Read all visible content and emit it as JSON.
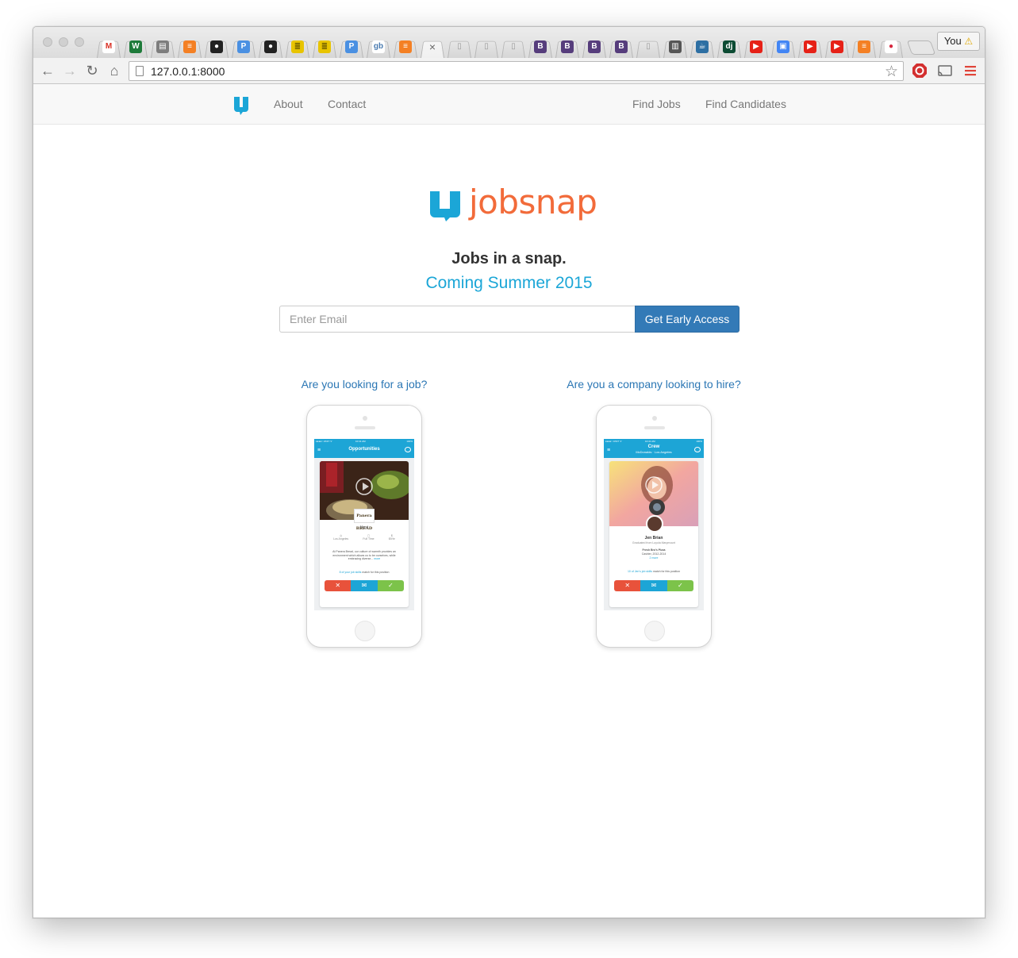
{
  "browser": {
    "profile_label": "You",
    "profile_warning": "⚠",
    "url": "127.0.0.1:8000",
    "tabs": [
      {
        "icon": "gmail-icon",
        "glyph": "M",
        "color": "#ffffff",
        "fg": "#d93025"
      },
      {
        "icon": "workflowy-icon",
        "glyph": "W",
        "color": "#1e7b3a",
        "fg": "#ffffff"
      },
      {
        "icon": "folder-icon",
        "glyph": "▤",
        "color": "#7d7d7d",
        "fg": "#ffffff"
      },
      {
        "icon": "stackoverflow-icon",
        "glyph": "≡",
        "color": "#f48024",
        "fg": "#ffffff"
      },
      {
        "icon": "github-icon",
        "glyph": "●",
        "color": "#222222",
        "fg": "#ffffff"
      },
      {
        "icon": "p-icon",
        "glyph": "P",
        "color": "#4a90e2",
        "fg": "#ffffff"
      },
      {
        "icon": "github-icon",
        "glyph": "●",
        "color": "#222222",
        "fg": "#ffffff"
      },
      {
        "icon": "database-icon",
        "glyph": "≣",
        "color": "#e8c400",
        "fg": "#5a4b00"
      },
      {
        "icon": "database-icon",
        "glyph": "≣",
        "color": "#e8c400",
        "fg": "#5a4b00"
      },
      {
        "icon": "p-icon",
        "glyph": "P",
        "color": "#4a90e2",
        "fg": "#ffffff"
      },
      {
        "icon": "gb-icon",
        "glyph": "gb",
        "color": "#ffffff",
        "fg": "#4a7bb0"
      },
      {
        "icon": "stackoverflow-icon",
        "glyph": "≡",
        "color": "#f48024",
        "fg": "#ffffff"
      },
      {
        "icon": "close-icon",
        "glyph": "×",
        "color": "transparent",
        "fg": "#666666"
      },
      {
        "icon": "page-icon",
        "glyph": "▯",
        "color": "transparent",
        "fg": "#999999"
      },
      {
        "icon": "page-icon",
        "glyph": "▯",
        "color": "transparent",
        "fg": "#999999"
      },
      {
        "icon": "page-icon",
        "glyph": "▯",
        "color": "transparent",
        "fg": "#999999"
      },
      {
        "icon": "bootstrap-icon",
        "glyph": "B",
        "color": "#563d7c",
        "fg": "#ffffff"
      },
      {
        "icon": "bootstrap-icon",
        "glyph": "B",
        "color": "#563d7c",
        "fg": "#ffffff"
      },
      {
        "icon": "bootstrap-icon",
        "glyph": "B",
        "color": "#563d7c",
        "fg": "#ffffff"
      },
      {
        "icon": "bootstrap-icon",
        "glyph": "B",
        "color": "#563d7c",
        "fg": "#ffffff"
      },
      {
        "icon": "page-icon",
        "glyph": "▯",
        "color": "transparent",
        "fg": "#999999"
      },
      {
        "icon": "columns-icon",
        "glyph": "▥",
        "color": "#555555",
        "fg": "#ffffff"
      },
      {
        "icon": "cup-icon",
        "glyph": "☕",
        "color": "#2d6fa3",
        "fg": "#ffffff"
      },
      {
        "icon": "django-icon",
        "glyph": "dj",
        "color": "#0c4b33",
        "fg": "#ffffff"
      },
      {
        "icon": "youtube-icon",
        "glyph": "▶",
        "color": "#e62117",
        "fg": "#ffffff"
      },
      {
        "icon": "bookmark-icon",
        "glyph": "▣",
        "color": "#4285f4",
        "fg": "#ffffff"
      },
      {
        "icon": "youtube-icon",
        "glyph": "▶",
        "color": "#e62117",
        "fg": "#ffffff"
      },
      {
        "icon": "youtube-icon",
        "glyph": "▶",
        "color": "#e62117",
        "fg": "#ffffff"
      },
      {
        "icon": "stackoverflow-icon",
        "glyph": "≡",
        "color": "#f48024",
        "fg": "#ffffff"
      },
      {
        "icon": "apple-icon",
        "glyph": "●",
        "color": "#ffffff",
        "fg": "#d7263d"
      }
    ]
  },
  "site": {
    "nav": {
      "about": "About",
      "contact": "Contact",
      "find_jobs": "Find Jobs",
      "find_candidates": "Find Candidates"
    },
    "brand": "jobsnap",
    "tagline": "Jobs in a snap.",
    "coming": "Coming Summer 2015",
    "email_placeholder": "Enter Email",
    "cta_label": "Get Early Access",
    "seeker_heading": "Are you looking for a job?",
    "company_heading": "Are you a company looking to hire?",
    "phone_seeker": {
      "carrier": "●●●●○ AT&T ᯤ",
      "time": "10:41 AM",
      "battery": "100%",
      "title": "Opportunities",
      "company": "Panera BREAD",
      "role": "Host",
      "meta": [
        "Los Angeles",
        "Full Time",
        "$9/hr"
      ],
      "desc": "At Panera Bread, our culture of warmth provides an environment which allows us to be ourselves, while embracing diverse...",
      "more": "more",
      "match_link": "8 of your job skills",
      "match_text": "match for this position"
    },
    "phone_company": {
      "carrier": "●●●●○ AT&T ᯤ",
      "time": "10:41 AM",
      "battery": "100%",
      "title": "Crew",
      "subtitle": "McDonalds · Los Angeles",
      "name": "Jen Brian",
      "school": "Graduated from Loyola Marymount",
      "employer": "Fresh Bro's Pizza",
      "position": "Cashier, 2012-2014",
      "more": "2 more",
      "match_link": "10 of Jen's job skills",
      "match_text": "match for this position"
    },
    "colors": {
      "brand_orange": "#f26b3a",
      "brand_blue": "#1ba6d7",
      "link": "#2a76b4",
      "button": "#337ab7",
      "reject": "#e8523b",
      "message": "#1da5d6",
      "accept": "#7cc34a"
    }
  }
}
